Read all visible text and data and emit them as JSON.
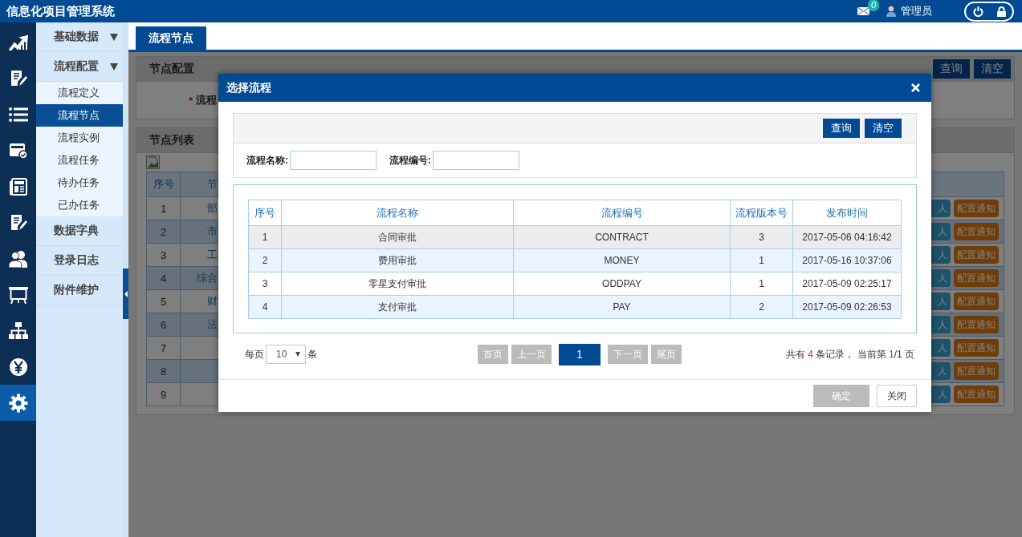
{
  "header": {
    "title": "信息化项目管理系统",
    "mail_count": "0",
    "user": "管理员"
  },
  "icon_bar": [
    {
      "kind": "chart",
      "selected": false
    },
    {
      "kind": "edit",
      "selected": false
    },
    {
      "kind": "list",
      "selected": false
    },
    {
      "kind": "card",
      "selected": false
    },
    {
      "kind": "news",
      "selected": false
    },
    {
      "kind": "edit",
      "selected": false
    },
    {
      "kind": "users",
      "selected": false
    },
    {
      "kind": "board",
      "selected": false
    },
    {
      "kind": "org",
      "selected": false
    },
    {
      "kind": "yen",
      "selected": false
    },
    {
      "kind": "gear",
      "selected": true
    }
  ],
  "menu": [
    {
      "kind": "group",
      "label": "基础数据"
    },
    {
      "kind": "group",
      "label": "流程配置",
      "children": [
        {
          "label": "流程定义",
          "selected": false
        },
        {
          "label": "流程节点",
          "selected": true
        },
        {
          "label": "流程实例",
          "selected": false
        },
        {
          "label": "流程任务",
          "selected": false
        },
        {
          "label": "待办任务",
          "selected": false
        },
        {
          "label": "已办任务",
          "selected": false
        }
      ]
    },
    {
      "kind": "link",
      "label": "数据字典"
    },
    {
      "kind": "link",
      "label": "登录日志"
    },
    {
      "kind": "link",
      "label": "附件维护"
    }
  ],
  "tabs": [
    {
      "label": "流程节点",
      "selected": true
    }
  ],
  "node_config": {
    "title": "节点配置",
    "buttons": [
      "查询",
      "清空"
    ],
    "required_mark": "*",
    "field_label": "流程"
  },
  "node_list": {
    "title": "节点列表",
    "columns": [
      "序号",
      "节"
    ],
    "rows": [
      {
        "index": "1",
        "name": "部",
        "actions": [
          "人",
          "配置通知"
        ]
      },
      {
        "index": "2",
        "name": "市",
        "actions": [
          "人",
          "配置通知"
        ]
      },
      {
        "index": "3",
        "name": "工",
        "actions": [
          "人",
          "配置通知"
        ]
      },
      {
        "index": "4",
        "name": "综合",
        "actions": [
          "人",
          "配置通知"
        ]
      },
      {
        "index": "5",
        "name": "财",
        "actions": [
          "人",
          "配置通知"
        ]
      },
      {
        "index": "6",
        "name": "法",
        "actions": [
          "人",
          "配置通知"
        ]
      },
      {
        "index": "7",
        "actions": [
          "人",
          "配置通知"
        ]
      },
      {
        "index": "8",
        "actions": [
          "人",
          "配置通知"
        ]
      },
      {
        "index": "9",
        "actions": [
          "人",
          "配置通知"
        ]
      }
    ]
  },
  "dialog": {
    "title": "选择流程",
    "search_buttons": [
      "查询",
      "清空"
    ],
    "fields": [
      {
        "label": "流程名称:"
      },
      {
        "label": "流程编号:"
      }
    ],
    "columns": [
      "序号",
      "流程名称",
      "流程编号",
      "流程版本号",
      "发布时间"
    ],
    "rows": [
      {
        "cells": [
          "1",
          "合同审批",
          "CONTRACT",
          "3",
          "2017-05-06 04:16:42"
        ],
        "hover": true
      },
      {
        "cells": [
          "2",
          "费用审批",
          "MONEY",
          "1",
          "2017-05-16 10:37:06"
        ],
        "hover": false
      },
      {
        "cells": [
          "3",
          "零星支付审批",
          "ODDPAY",
          "1",
          "2017-05-09 02:25:17"
        ],
        "hover": false
      },
      {
        "cells": [
          "4",
          "支付审批",
          "PAY",
          "2",
          "2017-05-09 02:26:53"
        ],
        "hover": false
      }
    ],
    "pager": {
      "per_page_label": "每页",
      "per_page": "10",
      "unit": "条",
      "buttons": [
        {
          "label": "首页",
          "kind": "nav"
        },
        {
          "label": "上一页",
          "kind": "nav"
        },
        {
          "label": "1",
          "kind": "page"
        },
        {
          "label": "下一页",
          "kind": "nav"
        },
        {
          "label": "尾页",
          "kind": "nav"
        }
      ],
      "summary": [
        {
          "text": "共有 ",
          "highlight": false
        },
        {
          "text": "4",
          "highlight": true
        },
        {
          "text": " 条记录， 当前第 ",
          "highlight": false
        },
        {
          "text": "1",
          "highlight": true
        },
        {
          "text": "/1 页",
          "highlight": false
        }
      ]
    },
    "footer_buttons": [
      {
        "label": "确定",
        "disabled": true
      },
      {
        "label": "关闭",
        "disabled": false
      }
    ]
  }
}
